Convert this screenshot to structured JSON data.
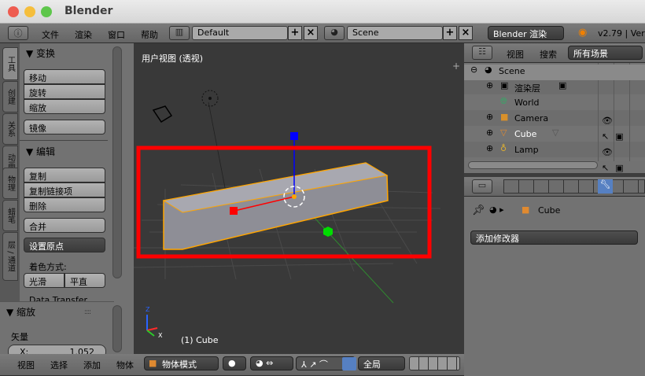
{
  "window": {
    "title": "Blender"
  },
  "top_menu": {
    "items": [
      "文件",
      "渲染",
      "窗口",
      "帮助"
    ],
    "layout": "Default",
    "scene": "Scene",
    "engine": "Blender 渲染",
    "version": "v2.79 | Ver"
  },
  "tool_tabs": [
    "工具",
    "创建",
    "关系",
    "动画",
    "物理",
    "蜡笔",
    "层 / 通道"
  ],
  "toolshelf": {
    "transform": {
      "title": "变换",
      "buttons": [
        "移动",
        "旋转",
        "缩放"
      ],
      "mirror": "镜像"
    },
    "edit": {
      "title": "编辑",
      "buttons": [
        "复制",
        "复制链接项",
        "删除"
      ],
      "join": "合并",
      "set_origin": "设置原点",
      "shading_label": "着色方式:",
      "smooth": "光滑",
      "flat": "平直",
      "data_transfer": "Data Transfer"
    },
    "scale_panel": {
      "title": "缩放",
      "vector_label": "矢量",
      "x_label": "X:",
      "x_value": "1.052"
    }
  },
  "viewport": {
    "view_label": "用户视图 (透视)",
    "object_label": "(1) Cube"
  },
  "footer": {
    "menus": [
      "视图",
      "选择",
      "添加",
      "物体"
    ],
    "mode": "物体模式",
    "orientation": "全局"
  },
  "outliner": {
    "view": "视图",
    "search": "搜索",
    "filter": "所有场景",
    "items": [
      {
        "name": "Scene"
      },
      {
        "name": "渲染层"
      },
      {
        "name": "World"
      },
      {
        "name": "Camera"
      },
      {
        "name": "Cube"
      },
      {
        "name": "Lamp"
      }
    ]
  },
  "properties": {
    "object_name": "Cube",
    "add_modifier": "添加修改器"
  },
  "colors": {
    "selection_box": "#ff0000",
    "selected_outline": "#ffa500",
    "active_tab": "#5680c2"
  }
}
